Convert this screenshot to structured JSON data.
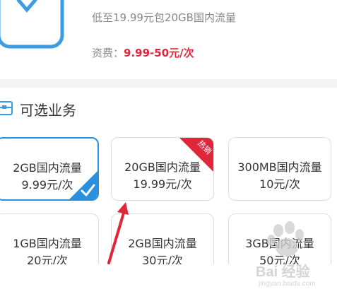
{
  "package": {
    "description": "低至19.99元包20GB国内流量",
    "fee_label": "资费：",
    "fee_value": "9.99-50元/次",
    "icon": "data-package-icon"
  },
  "section": {
    "title": "可选业务",
    "icon": "briefcase-icon"
  },
  "options": [
    {
      "name": "2GB国内流量",
      "price": "9.99元/次",
      "selected": true
    },
    {
      "name": "20GB国内流量",
      "price": "19.99元/次",
      "badge": "热销"
    },
    {
      "name": "300MB国内流量",
      "price": "10元/次"
    },
    {
      "name": "1GB国内流量",
      "price": "20元/次"
    },
    {
      "name": "2GB国内流量",
      "price": "30元/次"
    },
    {
      "name": "3GB国内流量",
      "price": "50元/次"
    }
  ],
  "watermark": {
    "brand": "Bai 经验",
    "url": "jingyan.baidu.com"
  },
  "colors": {
    "accent": "#2b8fe0",
    "price_red": "#e0263b",
    "hot_badge": "#e0263b",
    "annotation_arrow": "#e0263b"
  }
}
